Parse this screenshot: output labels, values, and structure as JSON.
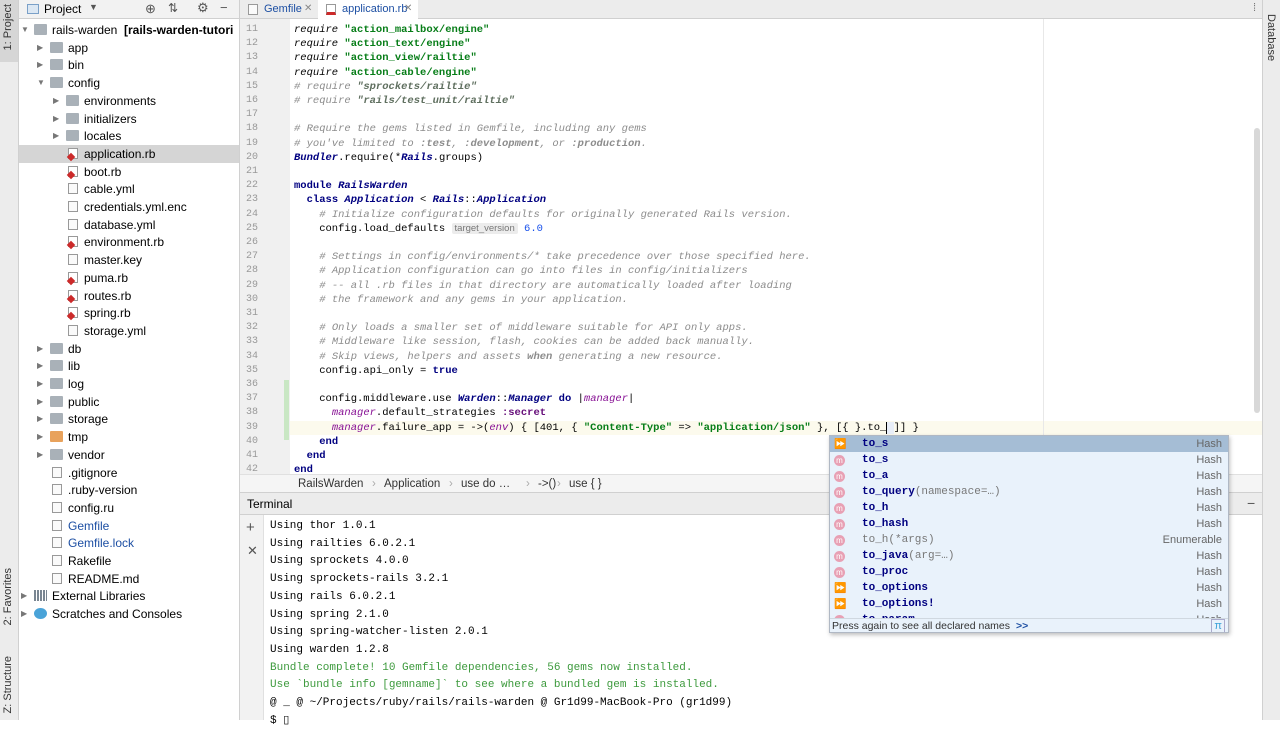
{
  "left_strip": {
    "project": "1: Project",
    "favorites": "2: Favorites",
    "structure": "Z: Structure"
  },
  "right_strip": {
    "database": "Database"
  },
  "project_panel": {
    "header": "Project",
    "tree": [
      {
        "label": "rails-warden",
        "suffix": "[rails-warden-tutori",
        "depth": 0,
        "kind": "folder",
        "expanded": true
      },
      {
        "label": "app",
        "depth": 1,
        "kind": "folder",
        "expanded": false
      },
      {
        "label": "bin",
        "depth": 1,
        "kind": "folder",
        "expanded": false
      },
      {
        "label": "config",
        "depth": 1,
        "kind": "folder",
        "expanded": true
      },
      {
        "label": "environments",
        "depth": 2,
        "kind": "folder",
        "expanded": false
      },
      {
        "label": "initializers",
        "depth": 2,
        "kind": "folder",
        "expanded": false
      },
      {
        "label": "locales",
        "depth": 2,
        "kind": "folder",
        "expanded": false
      },
      {
        "label": "application.rb",
        "depth": 2,
        "kind": "rb",
        "selected": true
      },
      {
        "label": "boot.rb",
        "depth": 2,
        "kind": "rb"
      },
      {
        "label": "cable.yml",
        "depth": 2,
        "kind": "txt"
      },
      {
        "label": "credentials.yml.enc",
        "depth": 2,
        "kind": "txt"
      },
      {
        "label": "database.yml",
        "depth": 2,
        "kind": "txt"
      },
      {
        "label": "environment.rb",
        "depth": 2,
        "kind": "rb"
      },
      {
        "label": "master.key",
        "depth": 2,
        "kind": "txt"
      },
      {
        "label": "puma.rb",
        "depth": 2,
        "kind": "rb"
      },
      {
        "label": "routes.rb",
        "depth": 2,
        "kind": "rb"
      },
      {
        "label": "spring.rb",
        "depth": 2,
        "kind": "rb"
      },
      {
        "label": "storage.yml",
        "depth": 2,
        "kind": "txt"
      },
      {
        "label": "db",
        "depth": 1,
        "kind": "folder",
        "expanded": false
      },
      {
        "label": "lib",
        "depth": 1,
        "kind": "folder",
        "expanded": false
      },
      {
        "label": "log",
        "depth": 1,
        "kind": "folder",
        "expanded": false
      },
      {
        "label": "public",
        "depth": 1,
        "kind": "folder",
        "expanded": false
      },
      {
        "label": "storage",
        "depth": 1,
        "kind": "folder",
        "expanded": false
      },
      {
        "label": "tmp",
        "depth": 1,
        "kind": "folder-tmp",
        "expanded": false
      },
      {
        "label": "vendor",
        "depth": 1,
        "kind": "folder",
        "expanded": false
      },
      {
        "label": ".gitignore",
        "depth": 1,
        "kind": "txt"
      },
      {
        "label": ".ruby-version",
        "depth": 1,
        "kind": "txt"
      },
      {
        "label": "config.ru",
        "depth": 1,
        "kind": "txt"
      },
      {
        "label": "Gemfile",
        "depth": 1,
        "kind": "txt",
        "color": "#1d4fa3"
      },
      {
        "label": "Gemfile.lock",
        "depth": 1,
        "kind": "txt",
        "color": "#1d4fa3"
      },
      {
        "label": "Rakefile",
        "depth": 1,
        "kind": "txt"
      },
      {
        "label": "README.md",
        "depth": 1,
        "kind": "txt"
      },
      {
        "label": "External Libraries",
        "depth": 0,
        "kind": "lib",
        "expanded": false
      },
      {
        "label": "Scratches and Consoles",
        "depth": 0,
        "kind": "scratch",
        "expanded": false
      }
    ]
  },
  "tabs": [
    {
      "label": "Gemfile",
      "active": false
    },
    {
      "label": "application.rb",
      "active": true
    }
  ],
  "editor": {
    "line_numbers": [
      "11",
      "12",
      "13",
      "14",
      "15",
      "16",
      "17",
      "18",
      "19",
      "20",
      "21",
      "22",
      "23",
      "24",
      "25",
      "26",
      "27",
      "28",
      "29",
      "30",
      "31",
      "32",
      "33",
      "34",
      "35",
      "36",
      "37",
      "38",
      "39",
      "40",
      "41",
      "42"
    ],
    "lines": [
      [
        [
          "kw2",
          "require "
        ],
        [
          "str",
          "\"action_mailbox/engine\""
        ]
      ],
      [
        [
          "kw2",
          "require "
        ],
        [
          "str",
          "\"action_text/engine\""
        ]
      ],
      [
        [
          "kw2",
          "require "
        ],
        [
          "str",
          "\"action_view/railtie\""
        ]
      ],
      [
        [
          "kw2",
          "require "
        ],
        [
          "str",
          "\"action_cable/engine\""
        ]
      ],
      [
        [
          "cm",
          "# require "
        ],
        [
          "cmstr",
          "\"sprockets/railtie\""
        ]
      ],
      [
        [
          "cm",
          "# require "
        ],
        [
          "cmstr",
          "\"rails/test_unit/railtie\""
        ]
      ],
      [],
      [
        [
          "cm",
          "# Require the gems listed in Gemfile, including any gems"
        ]
      ],
      [
        [
          "cm",
          "# you've limited to "
        ],
        [
          "cmsym",
          ":test"
        ],
        [
          "cm",
          ", "
        ],
        [
          "cmsym",
          ":development"
        ],
        [
          "cm",
          ", or "
        ],
        [
          "cmsym",
          ":production"
        ],
        [
          "cm",
          "."
        ]
      ],
      [
        [
          "const",
          "Bundler"
        ],
        [
          "n",
          ".require(*"
        ],
        [
          "const",
          "Rails"
        ],
        [
          "n",
          ".groups)"
        ]
      ],
      [],
      [
        [
          "kw",
          "module "
        ],
        [
          "const",
          "RailsWarden"
        ]
      ],
      [
        [
          "n",
          "  "
        ],
        [
          "kw",
          "class "
        ],
        [
          "const",
          "Application"
        ],
        [
          "n",
          " < "
        ],
        [
          "const",
          "Rails"
        ],
        [
          "n",
          "::"
        ],
        [
          "const",
          "Application"
        ]
      ],
      [
        [
          "n",
          "    "
        ],
        [
          "cm",
          "# Initialize configuration defaults for originally generated Rails version."
        ]
      ],
      [
        [
          "n",
          "    config.load_defaults "
        ],
        [
          "hint",
          "target_version"
        ],
        [
          "num",
          " 6.0"
        ]
      ],
      [],
      [
        [
          "n",
          "    "
        ],
        [
          "cm",
          "# Settings in config/environments/* take precedence over those specified here."
        ]
      ],
      [
        [
          "n",
          "    "
        ],
        [
          "cm",
          "# Application configuration can go into files in config/initializers"
        ]
      ],
      [
        [
          "n",
          "    "
        ],
        [
          "cm",
          "# -- all .rb files in that directory are automatically loaded after loading"
        ]
      ],
      [
        [
          "n",
          "    "
        ],
        [
          "cm",
          "# the framework and any gems in your application."
        ]
      ],
      [],
      [
        [
          "n",
          "    "
        ],
        [
          "cm",
          "# Only loads a smaller set of middleware suitable for API only apps."
        ]
      ],
      [
        [
          "n",
          "    "
        ],
        [
          "cm",
          "# Middleware like session, flash, cookies can be added back manually."
        ]
      ],
      [
        [
          "n",
          "    "
        ],
        [
          "cm",
          "# Skip views, helpers and assets "
        ],
        [
          "cmkw",
          "when"
        ],
        [
          "cm",
          " generating a new resource."
        ]
      ],
      [
        [
          "n",
          "    config.api_only = "
        ],
        [
          "kw",
          "true"
        ]
      ],
      [],
      [
        [
          "n",
          "    config.middleware.use "
        ],
        [
          "const",
          "Warden"
        ],
        [
          "n",
          "::"
        ],
        [
          "const",
          "Manager"
        ],
        [
          "n",
          " "
        ],
        [
          "kw",
          "do"
        ],
        [
          "n",
          " |"
        ],
        [
          "par",
          "manager"
        ],
        [
          "n",
          "|"
        ]
      ],
      [
        [
          "n",
          "      "
        ],
        [
          "par",
          "manager"
        ],
        [
          "n",
          ".default_strategies "
        ],
        [
          "sym",
          ":secret"
        ]
      ],
      [
        [
          "n",
          "      "
        ],
        [
          "par",
          "manager"
        ],
        [
          "n",
          ".failure_app = ->("
        ],
        [
          "par",
          "env"
        ],
        [
          "n",
          ") { [401, { "
        ],
        [
          "str",
          "\"Content-Type\""
        ],
        [
          "n",
          " => "
        ],
        [
          "str",
          "\"application/json\""
        ],
        [
          "n",
          " }, [{ }.to_"
        ],
        [
          "cursor",
          "|"
        ],
        [
          "n",
          "]] }"
        ]
      ],
      [
        [
          "n",
          "    "
        ],
        [
          "kw",
          "end"
        ]
      ],
      [
        [
          "n",
          "  "
        ],
        [
          "kw",
          "end"
        ]
      ],
      [
        [
          "kw",
          "end"
        ]
      ]
    ]
  },
  "breadcrumbs": [
    "RailsWarden",
    "Application",
    "use do …",
    "->()",
    "use { }"
  ],
  "terminal": {
    "title": "Terminal",
    "lines": [
      {
        "text": "Using thor 1.0.1",
        "green": false
      },
      {
        "text": "Using railties 6.0.2.1",
        "green": false
      },
      {
        "text": "Using sprockets 4.0.0",
        "green": false
      },
      {
        "text": "Using sprockets-rails 3.2.1",
        "green": false
      },
      {
        "text": "Using rails 6.0.2.1",
        "green": false
      },
      {
        "text": "Using spring 2.1.0",
        "green": false
      },
      {
        "text": "Using spring-watcher-listen 2.0.1",
        "green": false
      },
      {
        "text": "Using warden 1.2.8",
        "green": false
      },
      {
        "text": "Bundle complete! 10 Gemfile dependencies, 56 gems now installed.",
        "green": true
      },
      {
        "text": "Use `bundle info [gemname]` to see where a bundled gem is installed.",
        "green": true
      },
      {
        "text": "@ _ @ ~/Projects/ruby/rails/rails-warden @ Gr1d99-MacBook-Pro (gr1d99)",
        "green": false
      },
      {
        "text": "$ ▯",
        "green": false
      }
    ]
  },
  "completion": {
    "items": [
      {
        "name": "to_s",
        "sig": "",
        "type": "Hash",
        "icon": "alias",
        "selected": true,
        "dim": false
      },
      {
        "name": "to_s",
        "sig": "",
        "type": "Hash",
        "icon": "m",
        "selected": false,
        "dim": false
      },
      {
        "name": "to_a",
        "sig": "",
        "type": "Hash",
        "icon": "m",
        "selected": false,
        "dim": false
      },
      {
        "name": "to_query",
        "sig": "(namespace=…)",
        "type": "Hash",
        "icon": "m",
        "selected": false,
        "dim": false
      },
      {
        "name": "to_h",
        "sig": "",
        "type": "Hash",
        "icon": "m",
        "selected": false,
        "dim": false
      },
      {
        "name": "to_hash",
        "sig": "",
        "type": "Hash",
        "icon": "m",
        "selected": false,
        "dim": false
      },
      {
        "name": "to_h",
        "sig": "(*args)",
        "type": "Enumerable",
        "icon": "m",
        "selected": false,
        "dim": true
      },
      {
        "name": "to_java",
        "sig": "(arg=…)",
        "type": "Hash",
        "icon": "m",
        "selected": false,
        "dim": false
      },
      {
        "name": "to_proc",
        "sig": "",
        "type": "Hash",
        "icon": "m",
        "selected": false,
        "dim": false
      },
      {
        "name": "to_options",
        "sig": "",
        "type": "Hash",
        "icon": "alias",
        "selected": false,
        "dim": false
      },
      {
        "name": "to_options!",
        "sig": "",
        "type": "Hash",
        "icon": "alias",
        "selected": false,
        "dim": false
      },
      {
        "name": "to_param",
        "sig": "",
        "type": "Hash",
        "icon": "m",
        "selected": false,
        "dim": false
      }
    ],
    "footer": "Press again to see all declared names",
    "footer_link": ">>",
    "pi": "π"
  }
}
